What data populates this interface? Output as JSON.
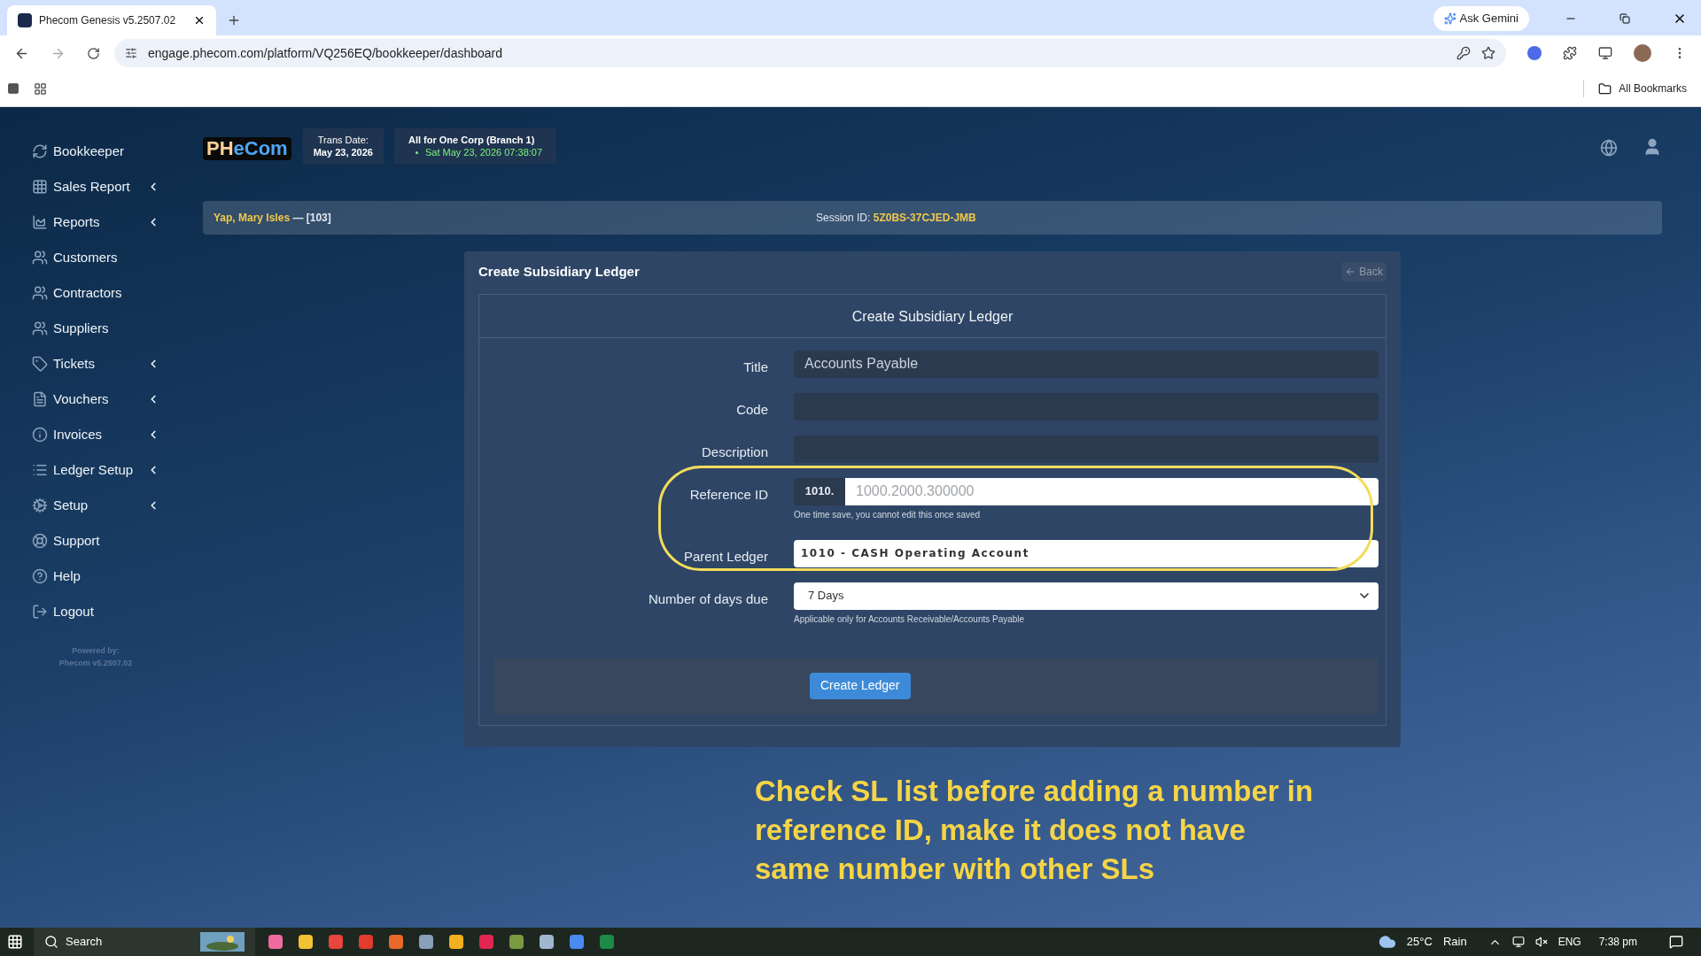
{
  "browser": {
    "tab_title": "Phecom Genesis v5.2507.02",
    "ask": "Ask Gemini",
    "url": "engage.phecom.com/platform/VQ256EQ/bookkeeper/dashboard",
    "bookmarks": "All Bookmarks"
  },
  "sidebar": {
    "items": [
      {
        "label": "Bookkeeper",
        "has_submenu": false
      },
      {
        "label": "Sales Report",
        "has_submenu": true
      },
      {
        "label": "Reports",
        "has_submenu": true
      },
      {
        "label": "Customers",
        "has_submenu": false
      },
      {
        "label": "Contractors",
        "has_submenu": false
      },
      {
        "label": "Suppliers",
        "has_submenu": false
      },
      {
        "label": "Tickets",
        "has_submenu": true
      },
      {
        "label": "Vouchers",
        "has_submenu": true
      },
      {
        "label": "Invoices",
        "has_submenu": true
      },
      {
        "label": "Ledger Setup",
        "has_submenu": true
      },
      {
        "label": "Setup",
        "has_submenu": true
      },
      {
        "label": "Support",
        "has_submenu": false
      },
      {
        "label": "Help",
        "has_submenu": false
      },
      {
        "label": "Logout",
        "has_submenu": false
      }
    ],
    "powered_by": "Powered by:",
    "version": "Phecom v5.2507.02"
  },
  "header": {
    "logo": [
      {
        "text": "PH"
      },
      {
        "text": "eCom"
      }
    ],
    "trans_date_label": "Trans Date:",
    "trans_date": "May 23, 2026",
    "company": "All for One Corp (Branch 1)",
    "clock": "Sat May 23, 2026 07:38:07"
  },
  "session_bar": {
    "user": "Yap, Mary Isles",
    "user_id": "— [103]",
    "session_label": "Session ID:",
    "session_id": "5Z0BS-37CJED-JMB"
  },
  "form": {
    "heading": "Create Subsidiary Ledger",
    "back": "Back",
    "panel_title": "Create Subsidiary Ledger",
    "fields": [
      {
        "kind": "text",
        "label": "Title",
        "value": "Accounts Payable",
        "highlighted": false
      },
      {
        "kind": "text",
        "label": "Code",
        "highlighted": false
      },
      {
        "kind": "text",
        "label": "Description",
        "highlighted": false
      },
      {
        "kind": "prefixed",
        "label": "Reference ID",
        "prefix": "1010.",
        "placeholder": "1000.2000.300000",
        "help": "One time save, you cannot edit this once saved",
        "highlighted": true
      },
      {
        "kind": "select",
        "label": "Parent Ledger",
        "value": "1010 - CASH Operating Account",
        "emphasis": true,
        "highlighted": true
      },
      {
        "kind": "select",
        "label": "Number of days due",
        "value": "7 Days",
        "emphasis": false,
        "help": "Applicable only for Accounts Receivable/Accounts Payable",
        "highlighted": false
      }
    ],
    "submit": "Create Ledger"
  },
  "annotation": "Check SL list before adding a number in reference ID, make it does not have same number with other SLs",
  "taskbar": {
    "search": "Search",
    "temperature": "25°C",
    "weather": "Rain",
    "language": "ENG",
    "time": "7:38 pm"
  }
}
